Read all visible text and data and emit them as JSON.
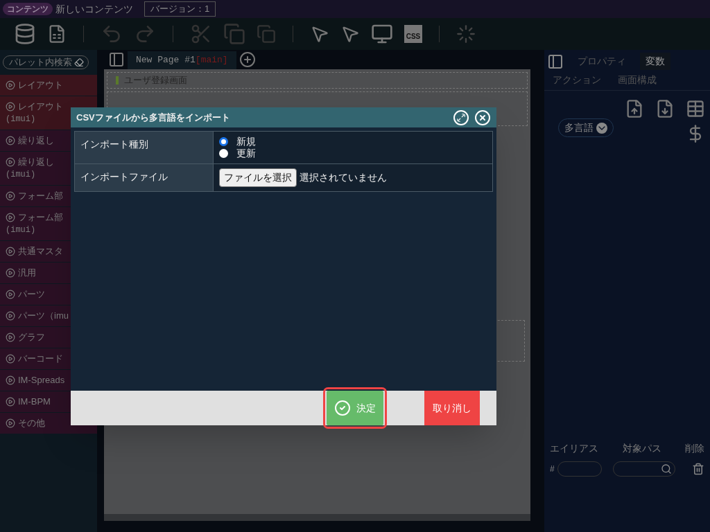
{
  "header": {
    "badge": "コンテンツ",
    "title": "新しいコンテンツ",
    "version": "バージョン：1"
  },
  "toolbar": {
    "css_label": "CSS"
  },
  "palette": {
    "search_placeholder": "パレット内検索",
    "items": [
      {
        "lines": [
          "レイアウト"
        ],
        "color": "#3b141c"
      },
      {
        "lines": [
          "レイアウト",
          "(imui)"
        ],
        "color": "#3b141c"
      },
      {
        "lines": [
          "繰り返し"
        ],
        "color": "#2b1024"
      },
      {
        "lines": [
          "繰り返し",
          "(imui)"
        ],
        "color": "#2b1024"
      },
      {
        "lines": [
          "フォーム部"
        ],
        "color": "#2b1024"
      },
      {
        "lines": [
          "フォーム部",
          "(imui)"
        ],
        "color": "#2b1024"
      },
      {
        "lines": [
          "共通マスタ"
        ],
        "color": "#2b1024"
      },
      {
        "lines": [
          "汎用"
        ],
        "color": "#2b1024"
      },
      {
        "lines": [
          "パーツ"
        ],
        "color": "#2b1024"
      },
      {
        "lines": [
          "パーツ（imu"
        ],
        "color": "#2b1024"
      },
      {
        "lines": [
          "グラフ"
        ],
        "color": "#2b1024"
      },
      {
        "lines": [
          "バーコード"
        ],
        "color": "#2b1024"
      },
      {
        "lines": [
          "IM-Spreads"
        ],
        "color": "#2b1024"
      },
      {
        "lines": [
          "IM-BPM"
        ],
        "color": "#2b1024"
      },
      {
        "lines": [
          "その他"
        ],
        "color": "#2b1024"
      }
    ]
  },
  "page_tab": {
    "label": "New Page #1",
    "suffix": "[main]",
    "selected": true
  },
  "page_title": "ユーザ登録画面",
  "right_panel": {
    "tabs": [
      {
        "label": "プロパティ",
        "selected": false
      },
      {
        "label": "変数",
        "selected": true
      },
      {
        "label": "アクション",
        "selected": false
      },
      {
        "label": "画面構成",
        "selected": false
      }
    ],
    "dropdown": "多言語",
    "columns": [
      "エイリアス",
      "対象パス",
      "削除"
    ],
    "alias_prefix": "#"
  },
  "dialog": {
    "title": "CSVファイルから多言語をインポート",
    "rows": [
      {
        "kind": "radio",
        "label": "インポート種別",
        "options": [
          {
            "label": "新規",
            "selected": true
          },
          {
            "label": "更新",
            "selected": false
          }
        ]
      },
      {
        "kind": "file",
        "label": "インポートファイル",
        "button": "ファイルを選択",
        "status": "選択されていません"
      }
    ],
    "buttons": [
      {
        "kind": "confirm",
        "label": "決定",
        "highlighted": true
      },
      {
        "kind": "cancel",
        "label": "取り消し",
        "highlighted": false
      }
    ]
  }
}
